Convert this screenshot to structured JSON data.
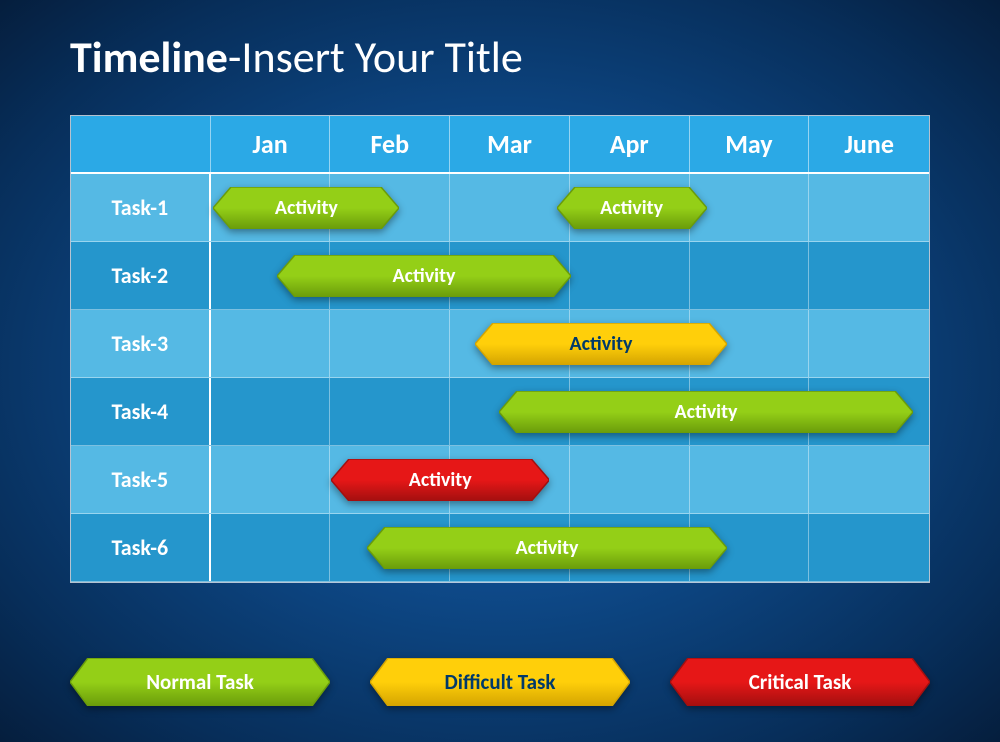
{
  "title_bold": "Timeline",
  "title_rest": "-Insert Your Title",
  "months": [
    "Jan",
    "Feb",
    "Mar",
    "Apr",
    "May",
    "June"
  ],
  "tasks": [
    "Task-1",
    "Task-2",
    "Task-3",
    "Task-4",
    "Task-5",
    "Task-6"
  ],
  "bars": [
    {
      "row": 0,
      "start": 0.02,
      "span": 1.55,
      "type": "normal",
      "label": "Activity"
    },
    {
      "row": 0,
      "start": 2.88,
      "span": 1.25,
      "type": "normal",
      "label": "Activity"
    },
    {
      "row": 1,
      "start": 0.55,
      "span": 2.45,
      "type": "normal",
      "label": "Activity"
    },
    {
      "row": 2,
      "start": 2.2,
      "span": 2.1,
      "type": "difficult",
      "label": "Activity"
    },
    {
      "row": 3,
      "start": 2.4,
      "span": 3.45,
      "type": "normal",
      "label": "Activity"
    },
    {
      "row": 4,
      "start": 1.0,
      "span": 1.82,
      "type": "critical",
      "label": "Activity"
    },
    {
      "row": 5,
      "start": 1.3,
      "span": 3.0,
      "type": "normal",
      "label": "Activity"
    }
  ],
  "legend": [
    {
      "type": "normal",
      "label": "Normal Task"
    },
    {
      "type": "difficult",
      "label": "Difficult Task"
    },
    {
      "type": "critical",
      "label": "Critical Task"
    }
  ],
  "colors": {
    "normal": {
      "fill": "#94cf17",
      "stroke": "#6a9c0a"
    },
    "difficult": {
      "fill": "#ffcf0a",
      "stroke": "#d4a400"
    },
    "critical": {
      "fill": "#e61717",
      "stroke": "#a30f0f"
    }
  },
  "chart_data": {
    "type": "bar",
    "title": "Timeline-Insert Your Title",
    "xlabel": "",
    "ylabel": "",
    "categories": [
      "Jan",
      "Feb",
      "Mar",
      "Apr",
      "May",
      "June"
    ],
    "rows": [
      "Task-1",
      "Task-2",
      "Task-3",
      "Task-4",
      "Task-5",
      "Task-6"
    ],
    "series": [
      {
        "name": "Activity",
        "row": "Task-1",
        "start_month": "Jan",
        "end_month": "Feb",
        "type": "normal"
      },
      {
        "name": "Activity",
        "row": "Task-1",
        "start_month": "Apr",
        "end_month": "May",
        "type": "normal"
      },
      {
        "name": "Activity",
        "row": "Task-2",
        "start_month": "Jan",
        "end_month": "Mar",
        "type": "normal"
      },
      {
        "name": "Activity",
        "row": "Task-3",
        "start_month": "Mar",
        "end_month": "May",
        "type": "difficult"
      },
      {
        "name": "Activity",
        "row": "Task-4",
        "start_month": "Mar",
        "end_month": "June",
        "type": "normal"
      },
      {
        "name": "Activity",
        "row": "Task-5",
        "start_month": "Feb",
        "end_month": "Mar",
        "type": "critical"
      },
      {
        "name": "Activity",
        "row": "Task-6",
        "start_month": "Feb",
        "end_month": "May",
        "type": "normal"
      }
    ],
    "legend": [
      "Normal Task",
      "Difficult Task",
      "Critical Task"
    ]
  }
}
